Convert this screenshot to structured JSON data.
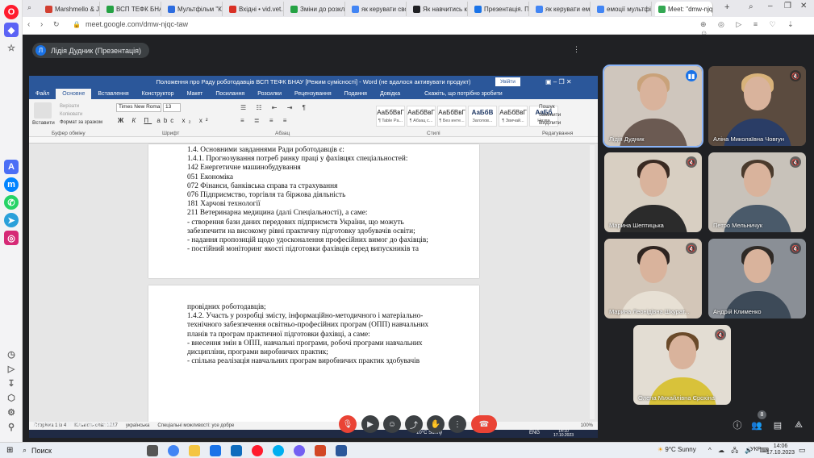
{
  "browser": {
    "tabs": [
      {
        "label": "Marshmello & Jonas",
        "color": "#d23f31"
      },
      {
        "label": "ВСП ТЕФК БНАУ",
        "color": "#25a244"
      },
      {
        "label": "Мультфільм \"Коро",
        "color": "#2d6cdf"
      },
      {
        "label": "Вхідні • vid.vet.med",
        "color": "#d93025"
      },
      {
        "label": "Зміни до розклад",
        "color": "#25a244"
      },
      {
        "label": "як керувати своїм",
        "color": "#4285f4"
      },
      {
        "label": "Як навчитись керу",
        "color": "#202124"
      },
      {
        "label": "Презентація. Приг",
        "color": "#1a73e8"
      },
      {
        "label": "як керувати емоці",
        "color": "#4285f4"
      },
      {
        "label": "емоції мультфільм",
        "color": "#4285f4"
      },
      {
        "label": "Meet: \"dmw-njqc",
        "color": "#34a853"
      }
    ],
    "url": "meet.google.com/dmw-njqc-taw"
  },
  "meet": {
    "presenter_initial": "Л",
    "presenter_label": "Лідія Дудник (Презентація)",
    "time": "14:06",
    "separator": "|",
    "meeting_code": "dmw-njqc-taw",
    "participants_count": "8",
    "participants": [
      {
        "name": "Лідія Дудник",
        "muted": false,
        "speaking": true
      },
      {
        "name": "Аліна Миколаївна Човгун",
        "muted": true
      },
      {
        "name": "Марина Шептицька",
        "muted": true
      },
      {
        "name": "Петро Мельничук",
        "muted": true
      },
      {
        "name": "Марина Леонідівна Шкурат...",
        "muted": true
      },
      {
        "name": "Андрій Клименко",
        "muted": true
      },
      {
        "name": "Олена Михайлівна Єрохіна",
        "muted": true
      }
    ]
  },
  "word": {
    "title": "Положення про Раду роботодавців ВСП ТЕФК БНАУ [Режим сумісності] - Word (не вдалося активувати продукт)",
    "signin": "Увійти",
    "tabs": [
      "Файл",
      "Основне",
      "Вставлення",
      "Конструктор",
      "Макет",
      "Посилання",
      "Розсилки",
      "Рецензування",
      "Подання",
      "Довідка"
    ],
    "tell_me": "Скажіть, що потрібно зробити",
    "paste": "Вставити",
    "clipboard_items": [
      "Вирізати",
      "Копіювати",
      "Формат за зразком"
    ],
    "font": "Times New Roma",
    "font_size": "13",
    "groups": [
      "Буфер обміну",
      "Шрифт",
      "Абзац",
      "Стилі",
      "Редагування"
    ],
    "styles": [
      {
        "sample": "АаБбВвГ",
        "name": "¶ Table Pa..."
      },
      {
        "sample": "АаБбВвГ",
        "name": "¶ Абзац с..."
      },
      {
        "sample": "АаБбВвГ",
        "name": "¶ Без инте..."
      },
      {
        "sample": "АаБбВ",
        "name": "Заголов..."
      },
      {
        "sample": "АаБбВвГ",
        "name": "¶ Звичай..."
      },
      {
        "sample": "АаБб",
        "name": "Назва"
      }
    ],
    "editing": [
      "Пошук",
      "Замінити",
      "Виділити"
    ],
    "page1_lines": [
      "1.4.    Основними завданнями Ради роботодавців є:",
      "1.4.1. Прогнозування потреб ринку праці у фахівцях спеціальностей:",
      "142 Енергетичне машинобудування",
      "051 Економіка",
      "072 Фінанси, банківська справа та страхування",
      "076 Підприємство, торгівля та біржова діяльність",
      "181 Харчові технології",
      "211 Ветеринарна медицина (далі Спеціальності), а саме:",
      "-  створення бази даних передових підприємств  України,         що         можуть",
      "забезпечити на високому рівні практичну підготовку здобувачів освіти;",
      "-  надання пропозицій щодо удосконалення професійних вимог до фахівців;",
      "-  постійний   моніторинг   якості   підготовки   фахівців   серед   випускників   та"
    ],
    "page2_lines": [
      "провідних роботодавців;",
      "1.4.2. Участь у розробці змісту, інформаційно-методичного і матеріально-",
      "технічного забезпечення освітньо-професійних програм (ОПП) навчальних",
      "планів та програм практичної підготовки фахівці, а саме:",
      "-  внесення змін в ОПП, навчальні програми, робочі програми навчальних",
      "дисципліни, програми виробничих практик;",
      "-  спільна реалізація навчальних програм виробничих практик здобувачів"
    ],
    "status": {
      "page": "Сторінка 1 із 4",
      "words": "Кількість слів: 1217",
      "lang": "українська",
      "access": "Спеціальні можливості: усе добре",
      "zoom": "100%"
    },
    "inner_taskbar": {
      "weather": "10°C  Sunny",
      "lang": "ENG",
      "time": "14:10",
      "date": "17.10.2023"
    }
  },
  "windows": {
    "search": "Поиск",
    "weather": "9°C  Sunny",
    "lang": "УКР",
    "time": "14:06",
    "date": "17.10.2023"
  }
}
